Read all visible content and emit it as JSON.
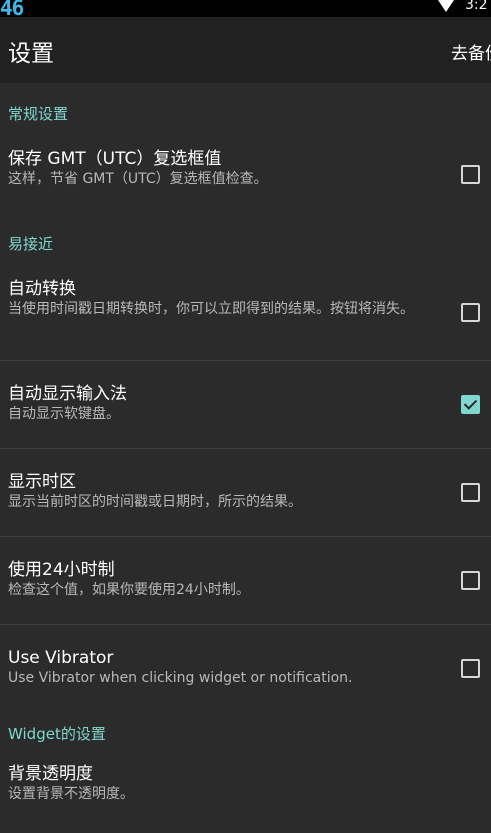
{
  "status_bar": {
    "signal_text": "46",
    "time": "3:2",
    "wifi_icon": "wifi-icon"
  },
  "action_bar": {
    "title": "设置",
    "action_label": "去备份"
  },
  "colors": {
    "accent": "#7fd8cf",
    "background": "#2b2b2b",
    "action_bar": "#212121",
    "status_bar_text": "#3db6e8"
  },
  "sections": {
    "general": {
      "header": "常规设置",
      "items": [
        {
          "title": "保存 GMT（UTC）复选框值",
          "summary": "这样，节省 GMT（UTC）复选框值检查。",
          "checked": false
        }
      ]
    },
    "accessibility": {
      "header": "易接近",
      "items": [
        {
          "title": "自动转换",
          "summary": "当使用时间戳日期转换时，你可以立即得到的结果。按钮将消失。",
          "checked": false
        },
        {
          "title": "自动显示输入法",
          "summary": "自动显示软键盘。",
          "checked": true
        },
        {
          "title": "显示时区",
          "summary": "显示当前时区的时间戳或日期时，所示的结果。",
          "checked": false
        },
        {
          "title": "使用24小时制",
          "summary": "检查这个值，如果你要使用24小时制。",
          "checked": false
        },
        {
          "title": "Use Vibrator",
          "summary": "Use Vibrator when clicking widget or notification.",
          "checked": false
        }
      ]
    },
    "widget": {
      "header": "Widget的设置",
      "items": [
        {
          "title": "背景透明度",
          "summary": "设置背景不透明度。"
        }
      ]
    }
  }
}
